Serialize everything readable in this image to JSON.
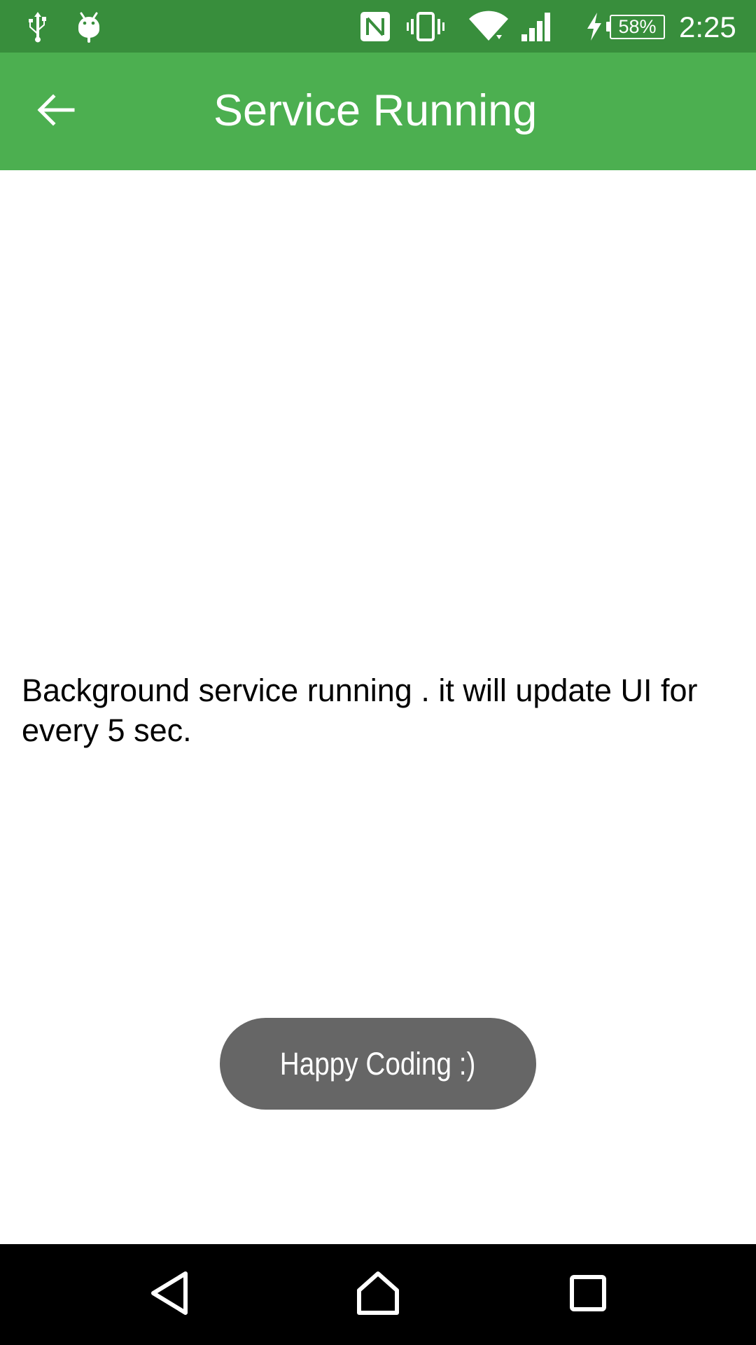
{
  "status_bar": {
    "icons": [
      "usb-icon",
      "android-debug-icon",
      "nfc-icon",
      "vibrate-icon",
      "wifi-icon",
      "cell-signal-icon",
      "charging-icon"
    ],
    "battery_percent": "58%",
    "time": "2:25"
  },
  "app_bar": {
    "title": "Service Running",
    "back_icon": "arrow-back-icon",
    "color": "#4caf50",
    "status_color": "#388e3c"
  },
  "content": {
    "message": "Background service running . it will update UI for every 5 sec."
  },
  "toast": {
    "text": "Happy Coding :)",
    "color": "#666666"
  },
  "nav_bar": {
    "buttons": [
      "back-triangle-icon",
      "home-icon",
      "recents-icon"
    ]
  }
}
